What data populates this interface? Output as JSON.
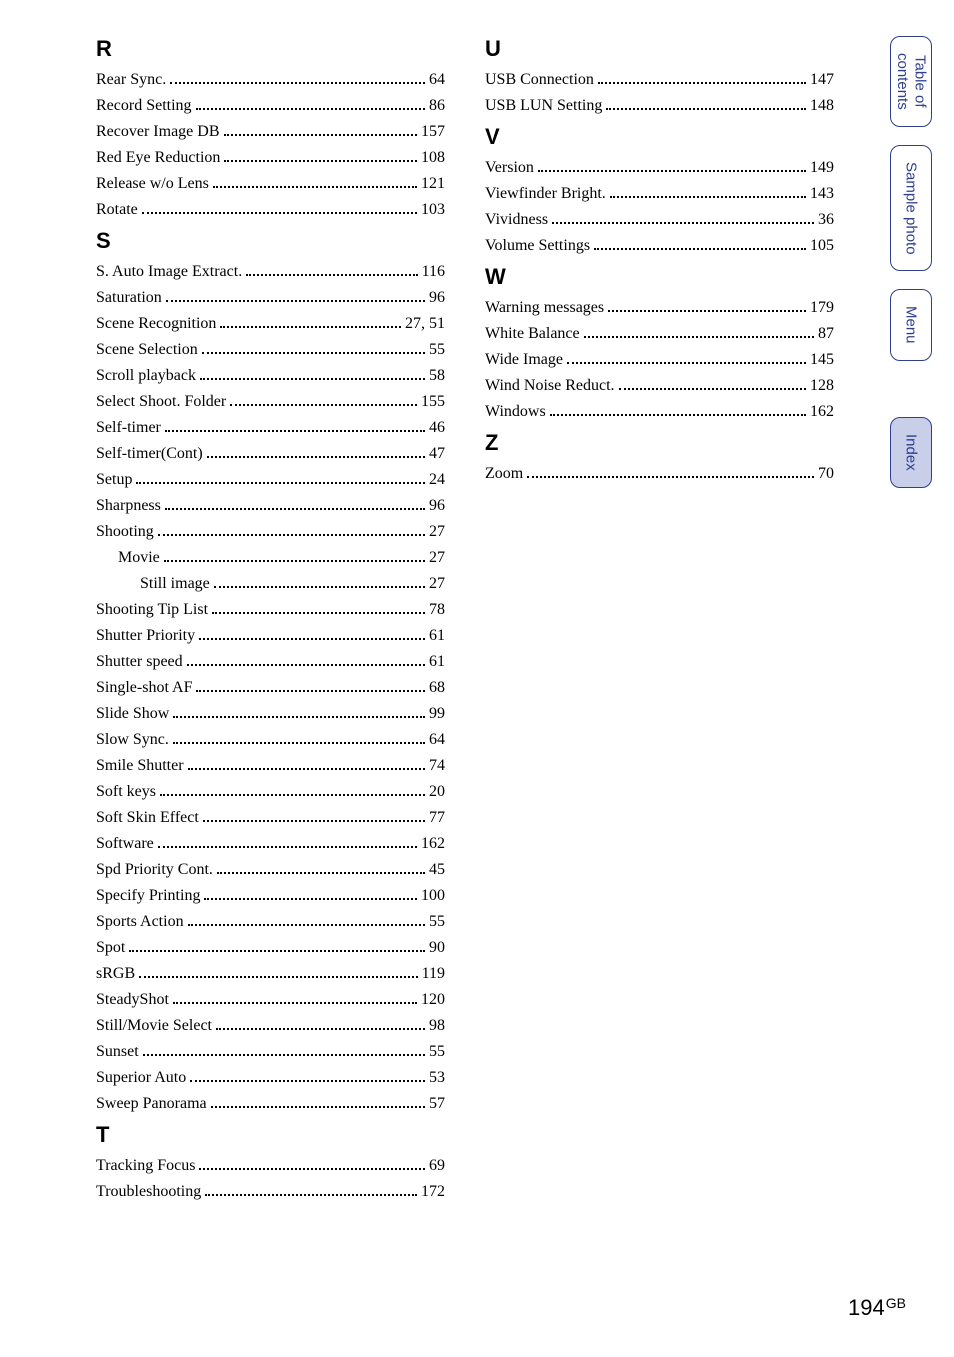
{
  "page": {
    "number": "194",
    "suffix": "GB"
  },
  "sidetabs": [
    {
      "id": "toc",
      "label": "Table of\ncontents",
      "active": false
    },
    {
      "id": "sample",
      "label": "Sample photo",
      "active": false
    },
    {
      "id": "menu",
      "label": "Menu",
      "active": false
    },
    {
      "id": "index",
      "label": "Index",
      "active": true,
      "gap": true
    }
  ],
  "left_sections": [
    {
      "heading": "R",
      "entries": [
        {
          "label": "Rear Sync.",
          "page": "64"
        },
        {
          "label": "Record Setting",
          "page": "86"
        },
        {
          "label": "Recover Image DB",
          "page": "157"
        },
        {
          "label": "Red Eye Reduction",
          "page": "108"
        },
        {
          "label": "Release w/o Lens",
          "page": "121"
        },
        {
          "label": "Rotate",
          "page": "103"
        }
      ]
    },
    {
      "heading": "S",
      "entries": [
        {
          "label": "S. Auto Image Extract.",
          "page": "116"
        },
        {
          "label": "Saturation",
          "page": "96"
        },
        {
          "label": "Scene Recognition",
          "page": "27, 51"
        },
        {
          "label": "Scene Selection",
          "page": "55"
        },
        {
          "label": "Scroll playback",
          "page": "58"
        },
        {
          "label": "Select Shoot. Folder",
          "page": "155"
        },
        {
          "label": "Self-timer",
          "page": "46"
        },
        {
          "label": "Self-timer(Cont)",
          "page": "47"
        },
        {
          "label": "Setup",
          "page": "24"
        },
        {
          "label": "Sharpness",
          "page": "96"
        },
        {
          "label": "Shooting",
          "page": "27"
        },
        {
          "label": "Movie",
          "page": "27",
          "indent": 1
        },
        {
          "label": "Still image",
          "page": "27",
          "indent": 2
        },
        {
          "label": "Shooting Tip List",
          "page": "78"
        },
        {
          "label": "Shutter Priority",
          "page": "61"
        },
        {
          "label": "Shutter speed",
          "page": "61"
        },
        {
          "label": "Single-shot AF",
          "page": "68"
        },
        {
          "label": "Slide Show",
          "page": "99"
        },
        {
          "label": "Slow Sync.",
          "page": "64"
        },
        {
          "label": "Smile Shutter",
          "page": "74"
        },
        {
          "label": "Soft keys",
          "page": "20"
        },
        {
          "label": "Soft Skin Effect",
          "page": "77"
        },
        {
          "label": "Software",
          "page": "162"
        },
        {
          "label": "Spd Priority Cont.",
          "page": "45"
        },
        {
          "label": "Specify Printing",
          "page": "100"
        },
        {
          "label": "Sports Action",
          "page": "55"
        },
        {
          "label": "Spot",
          "page": "90"
        },
        {
          "label": "sRGB",
          "page": "119"
        },
        {
          "label": "SteadyShot",
          "page": "120"
        },
        {
          "label": "Still/Movie Select",
          "page": "98"
        },
        {
          "label": "Sunset",
          "page": "55"
        },
        {
          "label": "Superior Auto",
          "page": "53"
        },
        {
          "label": "Sweep Panorama",
          "page": "57"
        }
      ]
    },
    {
      "heading": "T",
      "entries": [
        {
          "label": "Tracking Focus",
          "page": "69"
        },
        {
          "label": "Troubleshooting",
          "page": "172"
        }
      ]
    }
  ],
  "right_sections": [
    {
      "heading": "U",
      "entries": [
        {
          "label": "USB Connection",
          "page": "147"
        },
        {
          "label": "USB LUN Setting",
          "page": "148"
        }
      ]
    },
    {
      "heading": "V",
      "entries": [
        {
          "label": "Version",
          "page": "149"
        },
        {
          "label": "Viewfinder Bright.",
          "page": "143"
        },
        {
          "label": "Vividness",
          "page": "36"
        },
        {
          "label": "Volume Settings",
          "page": "105"
        }
      ]
    },
    {
      "heading": "W",
      "entries": [
        {
          "label": "Warning messages",
          "page": "179"
        },
        {
          "label": "White Balance",
          "page": "87"
        },
        {
          "label": "Wide Image",
          "page": "145"
        },
        {
          "label": "Wind Noise Reduct.",
          "page": "128"
        },
        {
          "label": "Windows",
          "page": "162"
        }
      ]
    },
    {
      "heading": "Z",
      "entries": [
        {
          "label": "Zoom",
          "page": "70"
        }
      ]
    }
  ]
}
